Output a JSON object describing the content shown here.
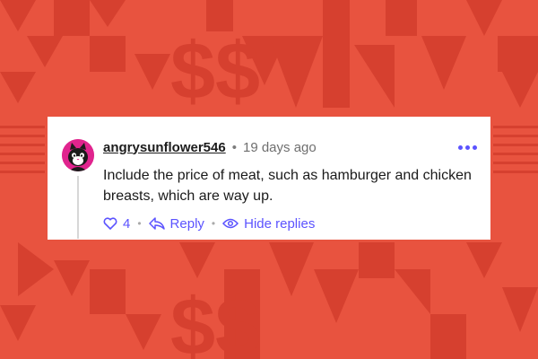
{
  "comment": {
    "username": "angrysunflower546",
    "separator": "•",
    "timestamp": "19 days ago",
    "body": "Include the price of meat, such as hamburger and chicken breasts, which are way up.",
    "actions": {
      "upvote_count": "4",
      "reply_label": "Reply",
      "hide_replies_label": "Hide replies",
      "sep": "•"
    }
  },
  "icons": {
    "avatar": "cat-avatar-icon",
    "upvote": "heart-icon",
    "reply": "reply-arrow-icon",
    "hide": "eye-icon",
    "more": "more-options-icon"
  },
  "colors": {
    "background": "#e8533f",
    "pattern": "#d6402f",
    "accent": "#5b53ff",
    "avatar_bg": "#e0248e"
  }
}
